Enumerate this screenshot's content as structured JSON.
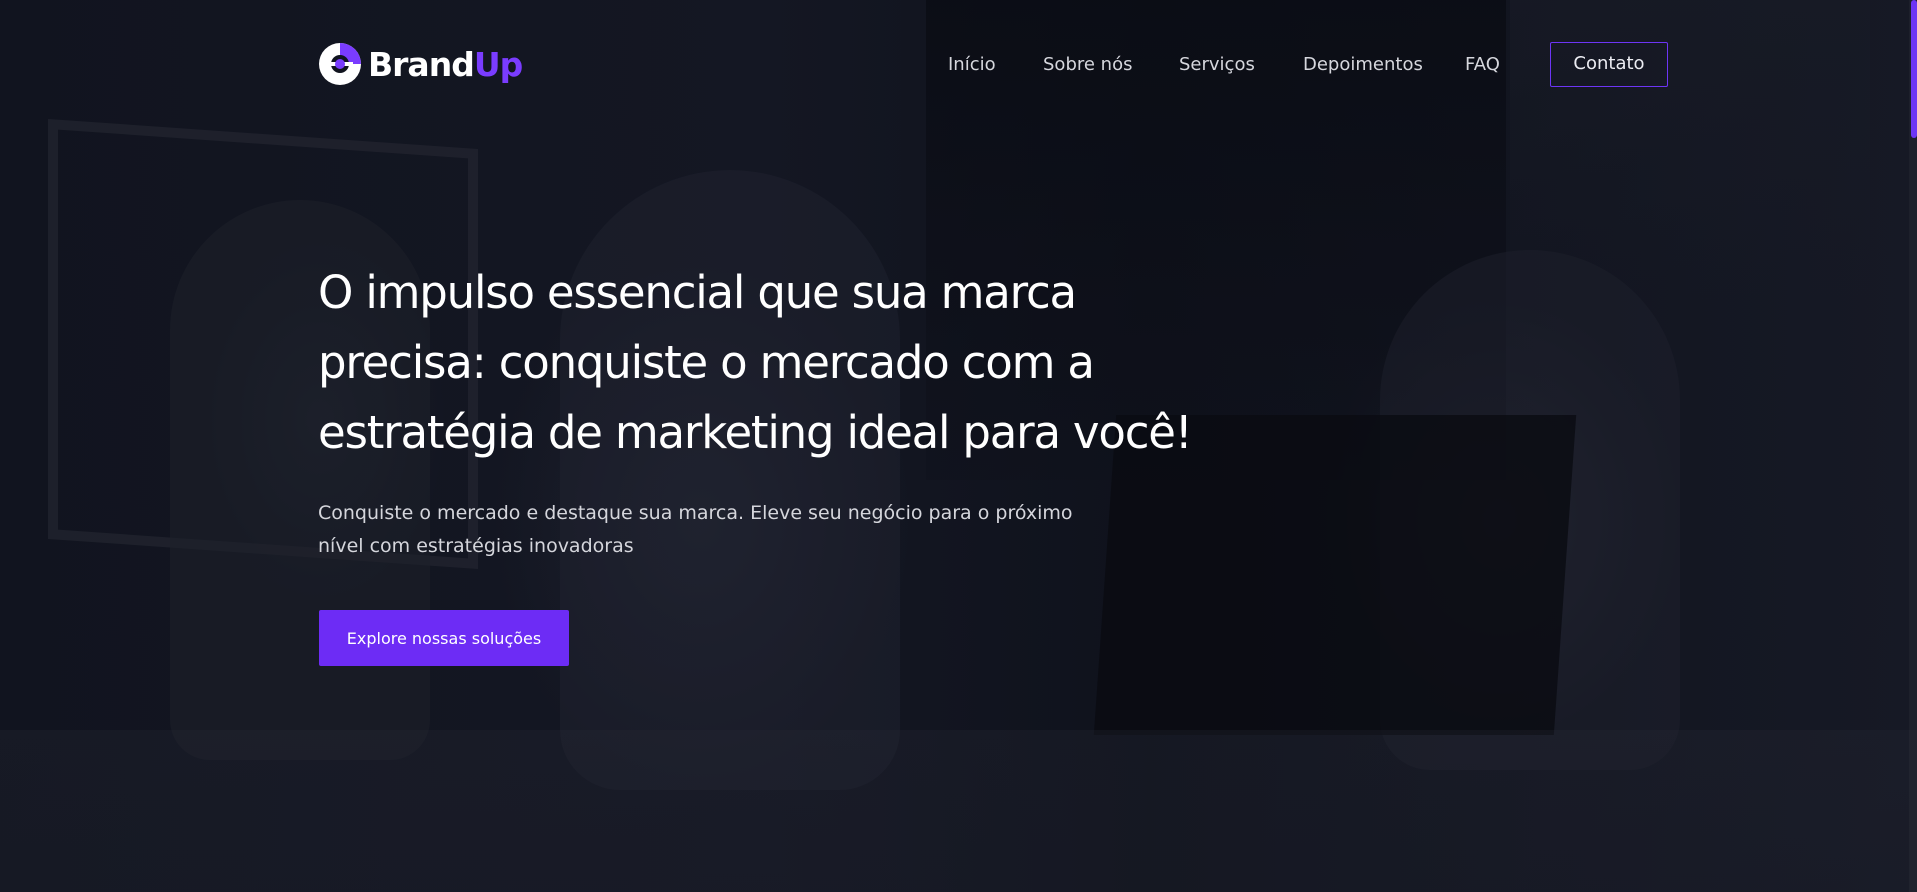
{
  "brand": {
    "name_part1": "Brand",
    "name_part2": "Up",
    "accent_color": "#7a3cff"
  },
  "nav": {
    "items": [
      {
        "label": "Início"
      },
      {
        "label": "Sobre nós"
      },
      {
        "label": "Serviços"
      },
      {
        "label": "Depoimentos"
      },
      {
        "label": "FAQ"
      }
    ],
    "contact_label": "Contato"
  },
  "hero": {
    "headline_lines": [
      "O impulso essencial que sua marca",
      "precisa: conquiste o mercado com a",
      "estratégia de marketing ideal para você!"
    ],
    "subtext_lines": [
      "Conquiste o mercado e destaque sua marca. Eleve seu negócio para o próximo",
      "nível com estratégias inovadoras"
    ],
    "cta_label": "Explore nossas soluções"
  },
  "colors": {
    "primary": "#6d2cf5",
    "background": "#11141f",
    "text": "#ffffff"
  },
  "icons": {
    "logo": "brand-logo-icon"
  }
}
